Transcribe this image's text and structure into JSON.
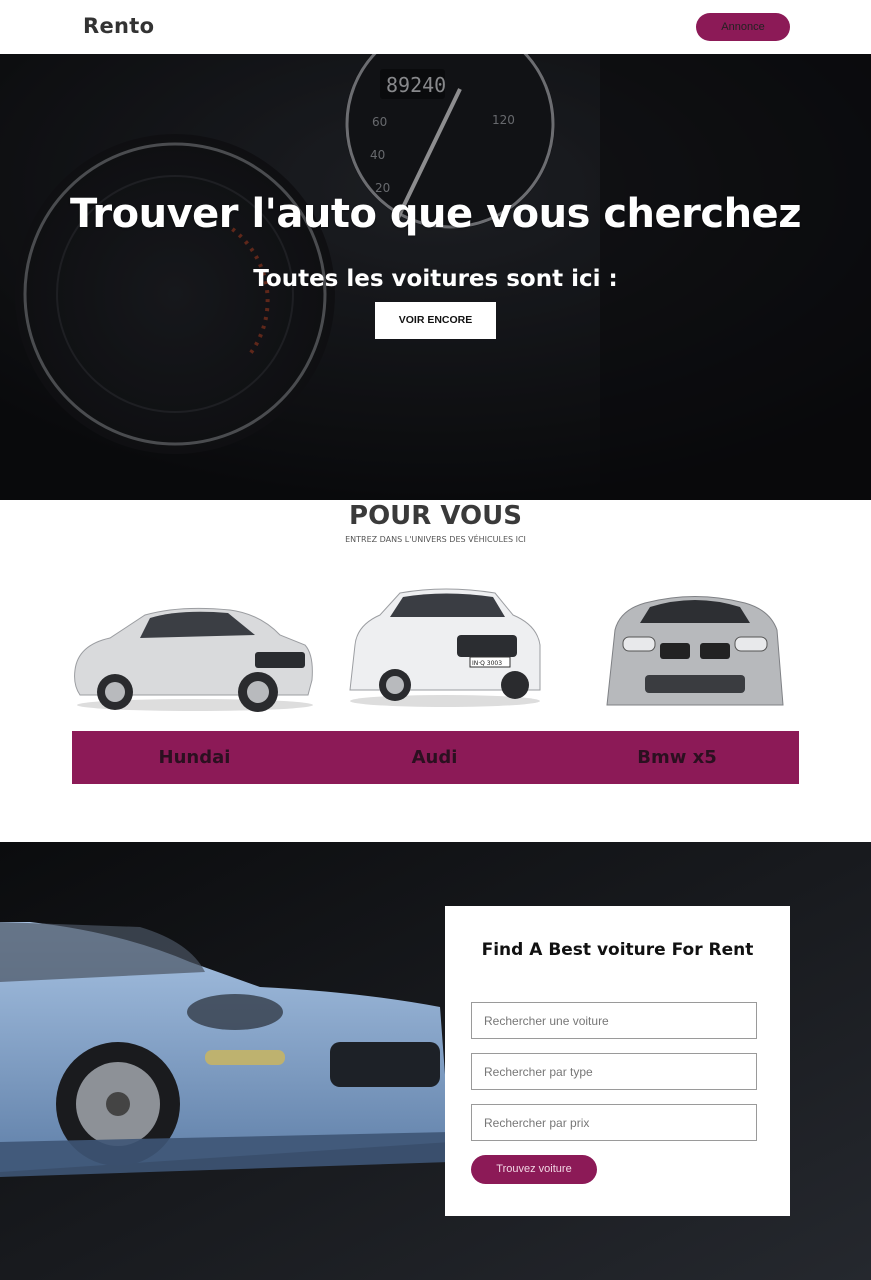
{
  "nav": {
    "logo": "Rento",
    "annonce_label": "Annonce"
  },
  "hero": {
    "title": "Trouver l'auto que vous cherchez",
    "subtitle": "Toutes les voitures sont ici :",
    "button_label": "VOIR ENCORE",
    "odometer": "89240"
  },
  "pour_vous": {
    "title": "POUR VOUS",
    "subtitle": "ENTREZ DANS L'UNIVERS DES VÉHICULES ICI",
    "cars": [
      {
        "name": "Hundai",
        "plate": ""
      },
      {
        "name": "Audi",
        "plate": "IN·Q 3003"
      },
      {
        "name": "Bmw x5",
        "plate": ""
      }
    ]
  },
  "search": {
    "title": "Find A Best voiture For Rent",
    "fields": [
      {
        "placeholder": "Rechercher une voiture"
      },
      {
        "placeholder": "Rechercher par type"
      },
      {
        "placeholder": "Rechercher par prix"
      }
    ],
    "button_label": "Trouvez voiture"
  },
  "colors": {
    "accent": "#8c1a57",
    "dark": "#16171b"
  }
}
